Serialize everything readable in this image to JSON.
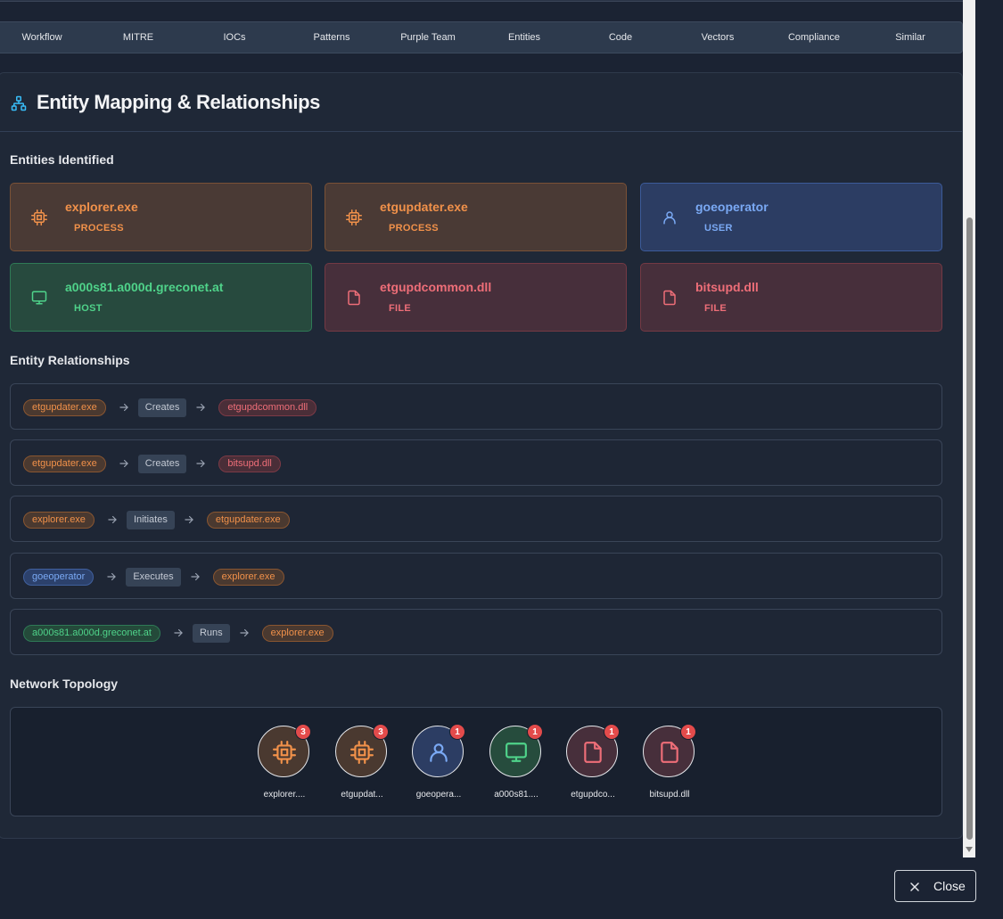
{
  "tabs": [
    "Workflow",
    "MITRE",
    "IOCs",
    "Patterns",
    "Purple Team",
    "Entities",
    "Code",
    "Vectors",
    "Compliance",
    "Similar"
  ],
  "panel": {
    "title": "Entity Mapping & Relationships",
    "icon": "network-icon"
  },
  "entities_section": {
    "title": "Entities Identified",
    "items": [
      {
        "name": "explorer.exe",
        "type": "PROCESS",
        "kind": "process",
        "icon": "cpu-icon"
      },
      {
        "name": "etgupdater.exe",
        "type": "PROCESS",
        "kind": "process",
        "icon": "cpu-icon"
      },
      {
        "name": "goeoperator",
        "type": "USER",
        "kind": "user",
        "icon": "user-icon"
      },
      {
        "name": "a000s81.a000d.greconet.at",
        "type": "HOST",
        "kind": "host",
        "icon": "monitor-icon"
      },
      {
        "name": "etgupdcommon.dll",
        "type": "FILE",
        "kind": "file",
        "icon": "file-icon"
      },
      {
        "name": "bitsupd.dll",
        "type": "FILE",
        "kind": "file",
        "icon": "file-icon"
      }
    ]
  },
  "relationships_section": {
    "title": "Entity Relationships",
    "items": [
      {
        "source": "etgupdater.exe",
        "source_kind": "process",
        "verb": "Creates",
        "target": "etgupdcommon.dll",
        "target_kind": "file"
      },
      {
        "source": "etgupdater.exe",
        "source_kind": "process",
        "verb": "Creates",
        "target": "bitsupd.dll",
        "target_kind": "file"
      },
      {
        "source": "explorer.exe",
        "source_kind": "process",
        "verb": "Initiates",
        "target": "etgupdater.exe",
        "target_kind": "process"
      },
      {
        "source": "goeoperator",
        "source_kind": "user",
        "verb": "Executes",
        "target": "explorer.exe",
        "target_kind": "process"
      },
      {
        "source": "a000s81.a000d.greconet.at",
        "source_kind": "host",
        "verb": "Runs",
        "target": "explorer.exe",
        "target_kind": "process"
      }
    ]
  },
  "topology_section": {
    "title": "Network Topology",
    "nodes": [
      {
        "label": "explorer....",
        "count": "3",
        "kind": "process",
        "icon": "cpu-icon"
      },
      {
        "label": "etgupdat...",
        "count": "3",
        "kind": "process",
        "icon": "cpu-icon"
      },
      {
        "label": "goeopera...",
        "count": "1",
        "kind": "user",
        "icon": "user-icon"
      },
      {
        "label": "a000s81....",
        "count": "1",
        "kind": "host",
        "icon": "monitor-icon"
      },
      {
        "label": "etgupdco...",
        "count": "1",
        "kind": "file",
        "icon": "file-icon"
      },
      {
        "label": "bitsupd.dll",
        "count": "1",
        "kind": "file",
        "icon": "file-icon"
      }
    ]
  },
  "footer": {
    "close_label": "Close"
  },
  "colors": {
    "process": "#f1914a",
    "user": "#7aa9f4",
    "host": "#4fd38a",
    "file": "#ee6e78",
    "badge": "#e34b4b"
  }
}
